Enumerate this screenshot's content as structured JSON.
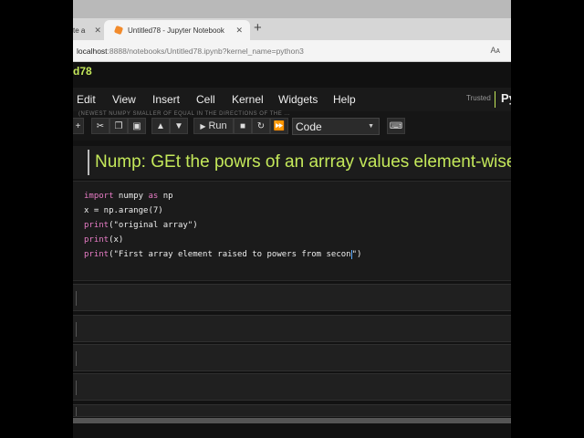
{
  "browser": {
    "prev_tab_label": "te a",
    "active_tab_label": "Untitled78 - Jupyter Notebook",
    "close_glyph": "✕",
    "new_tab_glyph": "+",
    "url_host": "localhost",
    "url_rest": ":8888/notebooks/Untitled78.ipynb?kernel_name=python3",
    "read_aloud_label": "Aᴀ"
  },
  "notebook": {
    "title": "d78",
    "menu": [
      "Edit",
      "View",
      "Insert",
      "Cell",
      "Kernel",
      "Widgets",
      "Help"
    ],
    "trusted_label": "Trusted",
    "kernel_label": "Py"
  },
  "toolbar": {
    "ghost_text": "(NEWEST NUMPY SMALLER OF EQUAL IN THE DIRECTIONS OF THE ...",
    "run_label": "Run",
    "cell_type": "Code",
    "accent": "#c4e85a"
  },
  "markdown_cell": {
    "heading": "Nump: GEt the powrs of an arrray values element-wise"
  },
  "code_cell": {
    "line1_kw1": "import",
    "line1_mod": " numpy ",
    "line1_kw2": "as",
    "line1_alias": " np",
    "line2": "x = np.arange(7)",
    "line3_fn": "print",
    "line3_arg": "(\"original array\")",
    "line4_fn": "print",
    "line4_arg": "(x)",
    "line5_fn": "print",
    "line5_arg": "(\"First array element raised to powers from secon",
    "line5_tail": "\")"
  },
  "empty_cell_count": 5
}
